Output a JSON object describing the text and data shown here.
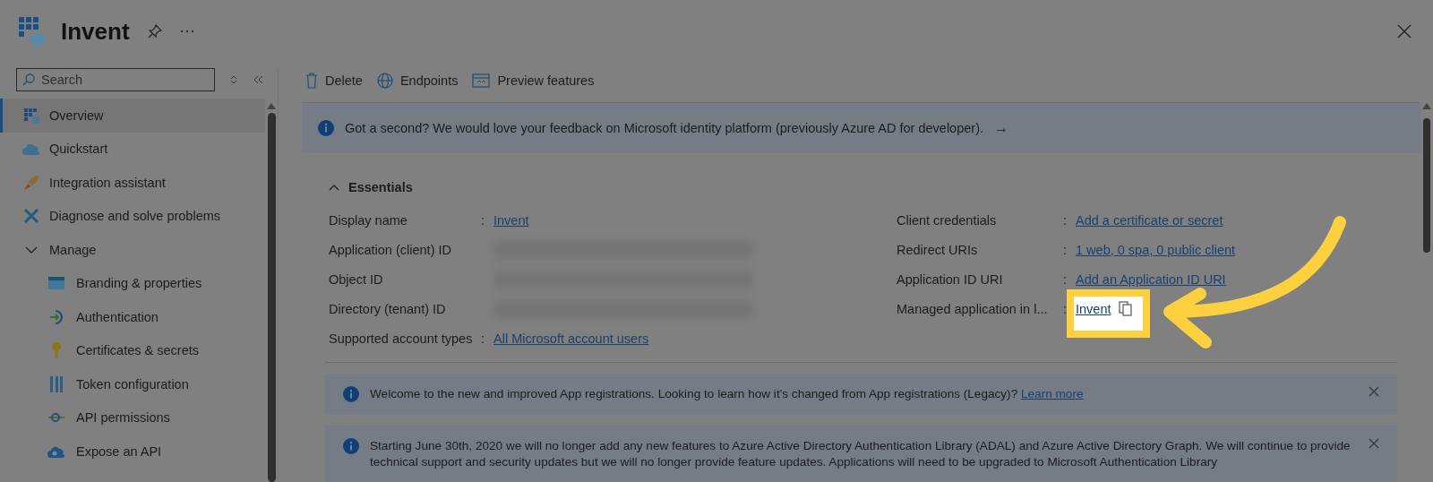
{
  "header": {
    "title": "Invent"
  },
  "sidebar": {
    "search": {
      "placeholder": "Search"
    },
    "items": [
      {
        "label": "Overview",
        "selected": true
      },
      {
        "label": "Quickstart",
        "selected": false
      },
      {
        "label": "Integration assistant",
        "selected": false
      },
      {
        "label": "Diagnose and solve problems",
        "selected": false
      },
      {
        "label": "Manage",
        "selected": false,
        "expanded": true,
        "children": [
          {
            "label": "Branding & properties",
            "selected": false
          },
          {
            "label": "Authentication",
            "selected": false
          },
          {
            "label": "Certificates & secrets",
            "selected": false
          },
          {
            "label": "Token configuration",
            "selected": false
          },
          {
            "label": "API permissions",
            "selected": false
          },
          {
            "label": "Expose an API",
            "selected": false
          }
        ]
      }
    ]
  },
  "toolbar": [
    "Delete",
    "Endpoints",
    "Preview features"
  ],
  "feedback_banner": {
    "text": "Got a second? We would love your feedback on Microsoft identity platform (previously Azure AD for developer).",
    "arrow": "→"
  },
  "essentials": {
    "title": "Essentials",
    "expanded": true,
    "left": [
      {
        "label": "Display name",
        "separator": ":",
        "kind": "link",
        "value": "Invent"
      },
      {
        "label": "Application (client) ID",
        "kind": "redacted"
      },
      {
        "label": "Object ID",
        "kind": "redacted"
      },
      {
        "label": "Directory (tenant) ID",
        "kind": "redacted"
      },
      {
        "label": "Supported account types",
        "separator": ":",
        "kind": "link",
        "value": "All Microsoft account users"
      }
    ],
    "right": [
      {
        "label": "Client credentials",
        "separator": ":",
        "kind": "link",
        "value": "Add a certificate or secret",
        "highlighted": false
      },
      {
        "label": "Redirect URIs",
        "separator": ":",
        "kind": "link",
        "value": "1 web, 0 spa, 0 public client",
        "highlighted": false
      },
      {
        "label": "Application ID URI",
        "separator": ":",
        "kind": "link",
        "value": "Add an Application ID URI",
        "highlighted": false
      },
      {
        "label": "Managed application in l...",
        "separator": ":",
        "kind": "link_copy",
        "value": "Invent",
        "highlighted": true
      }
    ]
  },
  "notices": [
    {
      "text": "Welcome to the new and improved App registrations. Looking to learn how it's changed from App registrations (Legacy)?",
      "link": "Learn more"
    },
    {
      "text": "Starting June 30th, 2020 we will no longer add any new features to Azure Active Directory Authentication Library (ADAL) and Azure Active Directory Graph. We will continue to provide technical support and security updates but we will no longer provide feature updates. Applications will need to be upgraded to Microsoft Authentication Library"
    }
  ]
}
